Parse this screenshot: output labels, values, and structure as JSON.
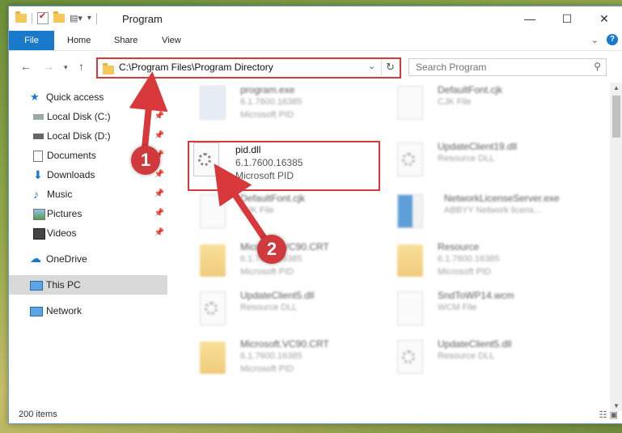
{
  "window": {
    "title": "Program"
  },
  "ribbon": {
    "file": "File",
    "home": "Home",
    "share": "Share",
    "view": "View",
    "help": "?"
  },
  "address": {
    "path": "C:\\Program Files\\Program Directory"
  },
  "search": {
    "placeholder": "Search Program"
  },
  "sidebar": {
    "quick_access": "Quick access",
    "items": [
      {
        "label": "Local Disk (C:)",
        "icon": "drive-icon"
      },
      {
        "label": "Local Disk (D:)",
        "icon": "drive-icon"
      },
      {
        "label": "Documents",
        "icon": "documents-icon"
      },
      {
        "label": "Downloads",
        "icon": "downloads-icon"
      },
      {
        "label": "Music",
        "icon": "music-icon"
      },
      {
        "label": "Pictures",
        "icon": "pictures-icon"
      },
      {
        "label": "Videos",
        "icon": "videos-icon"
      }
    ],
    "onedrive": "OneDrive",
    "this_pc": "This PC",
    "network": "Network"
  },
  "files": [
    {
      "name": "program.exe",
      "l2": "6.1.7600.16385",
      "l3": "Microsoft PID",
      "icon": "exe"
    },
    {
      "name": "DefaultFont.cjk",
      "l2": "CJK File",
      "l3": "",
      "icon": "file"
    },
    {
      "name": "pid.dll",
      "l2": "6.1.7600.16385",
      "l3": "Microsoft PID",
      "icon": "dll"
    },
    {
      "name": "UpdateClient19.dll",
      "l2": "Resource DLL",
      "l3": "",
      "icon": "dll"
    },
    {
      "name": "DefaultFont.cjk",
      "l2": "CJK File",
      "l3": "",
      "icon": "file"
    },
    {
      "name": "NetworkLicenseServer.exe",
      "l2": "ABBYY Network licens...",
      "l3": "",
      "icon": "exe"
    },
    {
      "name": "Microsoft.VC90.CRT",
      "l2": "6.1.7600.16385",
      "l3": "Microsoft PID",
      "icon": "folder"
    },
    {
      "name": "Resource",
      "l2": "6.1.7600.16385",
      "l3": "Microsoft PID",
      "icon": "folder"
    },
    {
      "name": "UpdateClient5.dll",
      "l2": "Resource DLL",
      "l3": "",
      "icon": "dll"
    },
    {
      "name": "SndToWP14.wcm",
      "l2": "WCM File",
      "l3": "",
      "icon": "file"
    },
    {
      "name": "Microsoft.VC90.CRT",
      "l2": "6.1.7600.16385",
      "l3": "Microsoft PID",
      "icon": "folder"
    },
    {
      "name": "UpdateClient5.dll",
      "l2": "Resource DLL",
      "l3": "",
      "icon": "dll"
    }
  ],
  "status": {
    "count": "200 items"
  },
  "annotations": {
    "step1": "1",
    "step2": "2",
    "color": "#d9383b"
  }
}
